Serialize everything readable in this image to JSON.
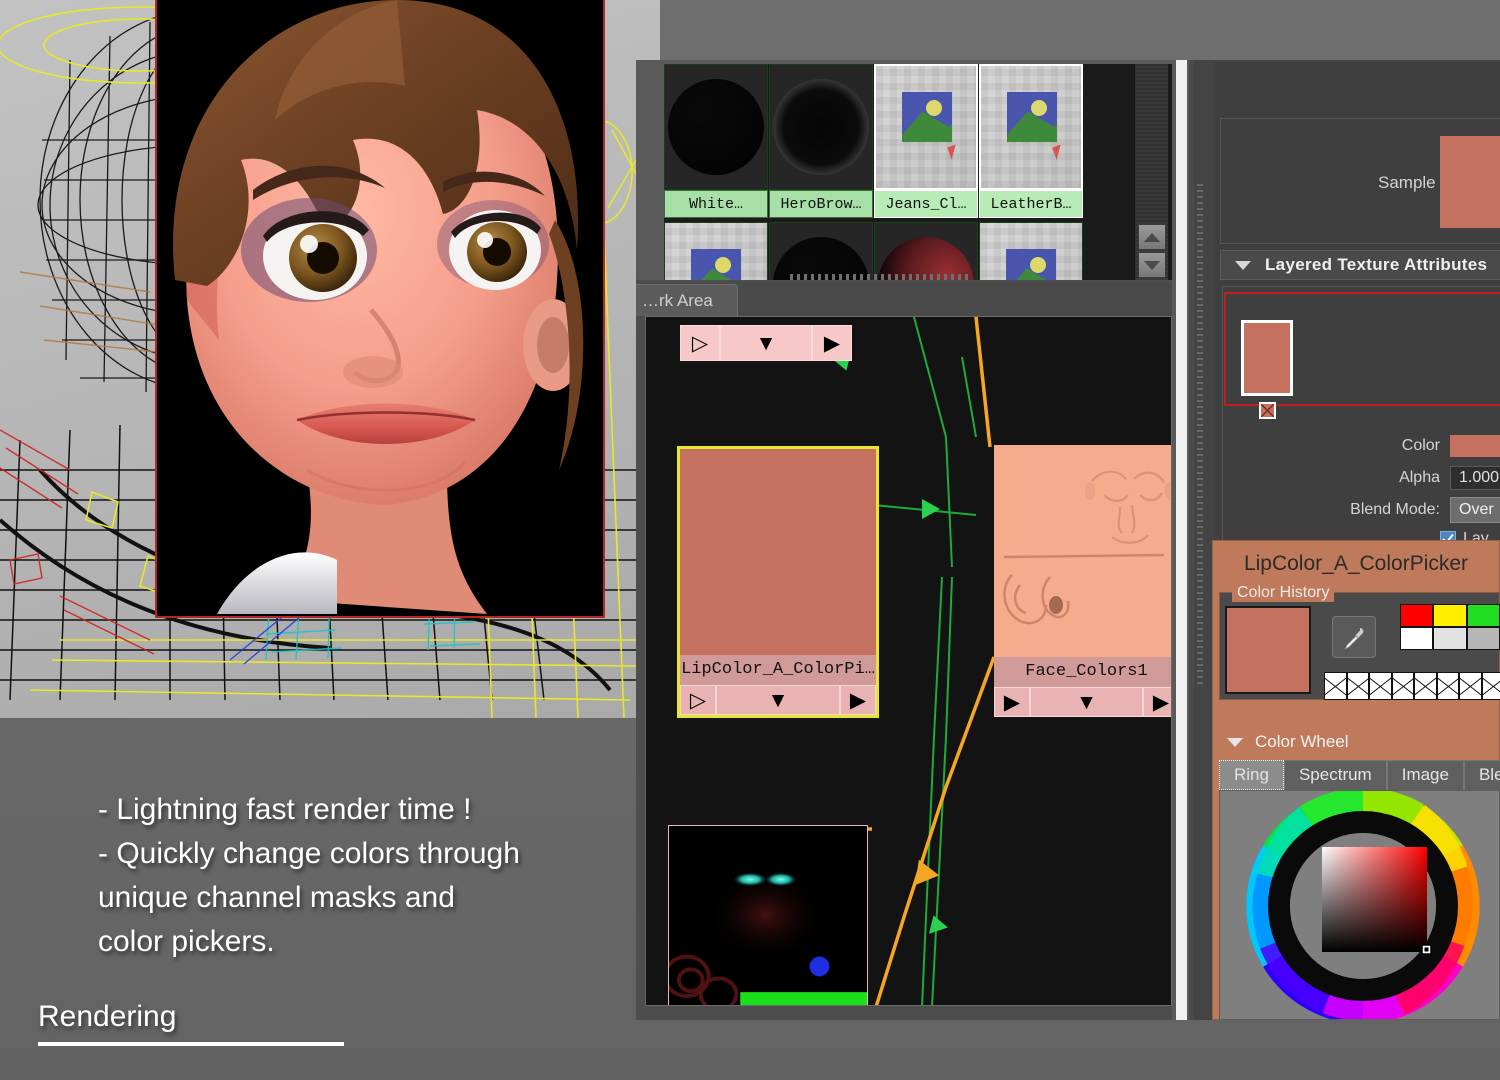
{
  "slide": {
    "bullets": [
      "- Lightning fast render time !",
      "- Quickly change colors through",
      "unique channel masks and",
      "color pickers."
    ],
    "section_label": "Rendering"
  },
  "hypershade": {
    "materials": [
      {
        "label": "White…",
        "thumb": "ball-black",
        "selected": false
      },
      {
        "label": "HeroBrow…",
        "thumb": "ball-ring",
        "selected": false
      },
      {
        "label": "Jeans_Cl…",
        "thumb": "file",
        "selected": true
      },
      {
        "label": "LeatherB…",
        "thumb": "file",
        "selected": true
      }
    ],
    "row2": [
      {
        "thumb": "file"
      },
      {
        "thumb": "ball-black"
      },
      {
        "thumb": "ball-red"
      },
      {
        "thumb": "file"
      }
    ],
    "scroll_up_icon": "scroll-up-arrow",
    "scroll_down_icon": "scroll-down-arrow"
  },
  "node_editor": {
    "tab_label": "…rk Area",
    "nodes": [
      {
        "name": "LipColor_A_ColorPi…",
        "color": "#c4715f",
        "selected": true,
        "left_port_icon": "output-arrow-outline",
        "mid_port_icon": "collapse-arrow-down",
        "right_port_icon": "input-arrow-filled"
      },
      {
        "name": "Face_Colors1",
        "color": "#f5ab8c",
        "selected": false,
        "left_port_icon": "input-arrow-filled",
        "mid_port_icon": "collapse-arrow-down",
        "right_port_icon": "output-arrow-filled"
      }
    ],
    "mask_node_name": "",
    "link_colors": {
      "green": "#1faa3c",
      "orange": "#f5a623"
    }
  },
  "attribute_editor": {
    "sample_label": "Sample",
    "sample_color": "#c4715f",
    "section_title": "Layered Texture Attributes",
    "section_caret_icon": "caret-down-icon",
    "layer_swatch_color": "#c4715f",
    "layer_delete_icon": "delete-x-icon",
    "rows": [
      {
        "label": "Color",
        "type": "swatch",
        "value": "#c4715f"
      },
      {
        "label": "Alpha",
        "type": "text",
        "value": "1.000"
      },
      {
        "label": "Blend Mode:",
        "type": "select",
        "value": "Over"
      }
    ],
    "layer_visible_label": "Lay…",
    "layer_visible_checked": true,
    "check_icon": "checkmark-icon"
  },
  "color_picker": {
    "title": "LipColor_A_ColorPicker",
    "history_legend": "Color History",
    "current_color": "#c4715f",
    "eyedropper_icon": "eyedropper-icon",
    "palette": [
      "#ff0000",
      "#ffee00",
      "#22dd22",
      "#ffffff",
      "#e2e2e2",
      "#b6b6b6"
    ],
    "empty_slot_icon": "empty-swatch-x-icon",
    "empty_slot_count": 8,
    "wheel_section_title": "Color Wheel",
    "wheel_caret_icon": "caret-down-icon",
    "tabs": [
      {
        "label": "Ring",
        "active": true
      },
      {
        "label": "Spectrum",
        "active": false
      },
      {
        "label": "Image",
        "active": false
      },
      {
        "label": "Ble…",
        "active": false
      }
    ],
    "wheel_type": "hue-ring-with-sv-square",
    "sv_marker_icon": "color-marker-icon"
  },
  "viewport": {
    "render_border_color": "#b02828",
    "wireframe_selection_color": "#e8e82a",
    "background_color": "#b4b4b4"
  }
}
